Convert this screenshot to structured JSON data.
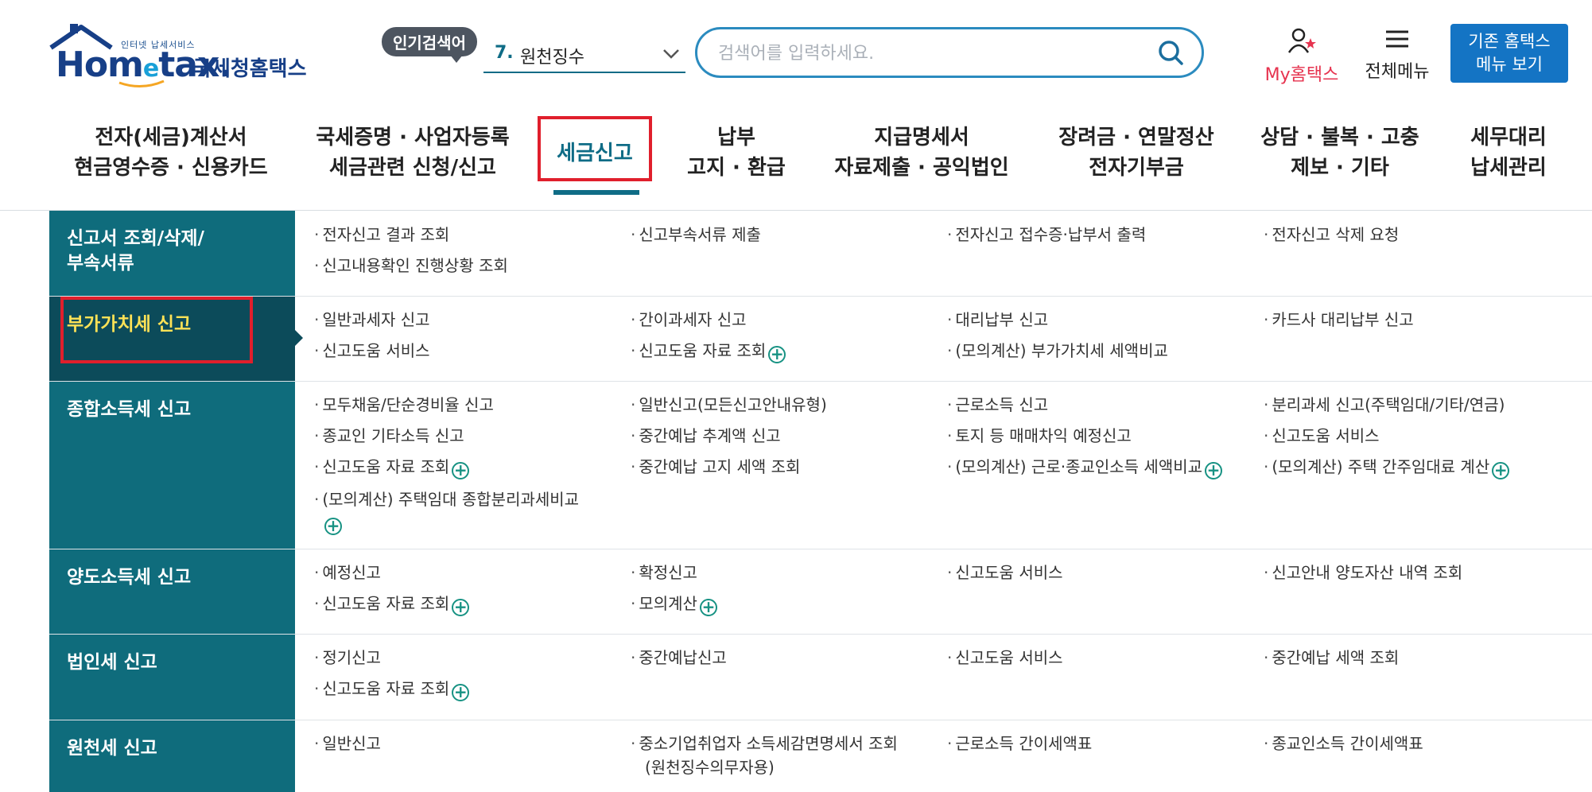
{
  "header": {
    "logo_small": "인터넷 납세서비스",
    "logo_word_a": "Hom",
    "logo_word_e": "e",
    "logo_word_b": "tax.",
    "logo_kr": "국세청홈택스",
    "popular_badge": "인기검색어",
    "popular_num": "7.",
    "popular_text": "원천징수",
    "search_placeholder": "검색어를 입력하세요.",
    "my_hometax": "My홈택스",
    "all_menu": "전체메뉴",
    "old_home_line1": "기존 홈택스",
    "old_home_line2": "메뉴 보기"
  },
  "gnb": [
    {
      "l1": "전자(세금)계산서",
      "l2": "현금영수증 · 신용카드"
    },
    {
      "l1": "국세증명 · 사업자등록",
      "l2": "세금관련 신청/신고"
    },
    {
      "l1": "세금신고",
      "l2": ""
    },
    {
      "l1": "납부",
      "l2": "고지 · 환급"
    },
    {
      "l1": "지급명세서",
      "l2": "자료제출 · 공익법인"
    },
    {
      "l1": "장려금 · 연말정산",
      "l2": "전자기부금"
    },
    {
      "l1": "상담 · 불복 · 고충",
      "l2": "제보 · 기타"
    },
    {
      "l1": "세무대리",
      "l2": "납세관리"
    }
  ],
  "rows": [
    {
      "cat": "신고서 조회/삭제/\n부속서류",
      "links": [
        "전자신고 결과 조회",
        "신고부속서류 제출",
        "전자신고 접수증·납부서 출력",
        "전자신고 삭제 요청",
        "신고내용확인 진행상황 조회"
      ]
    },
    {
      "cat": "부가가치세 신고",
      "links": [
        "일반과세자 신고",
        "간이과세자 신고",
        "대리납부 신고",
        "카드사 대리납부 신고",
        "신고도움 서비스",
        "신고도움 자료 조회",
        "(모의계산) 부가가치세 세액비교"
      ]
    },
    {
      "cat": "종합소득세 신고",
      "links": [
        "모두채움/단순경비율 신고",
        "일반신고(모든신고안내유형)",
        "근로소득 신고",
        "분리과세 신고(주택임대/기타/연금)",
        "종교인 기타소득 신고",
        "중간예납 추계액 신고",
        "토지 등 매매차익 예정신고",
        "신고도움 서비스",
        "신고도움 자료 조회",
        "중간예납 고지 세액 조회",
        "(모의계산) 근로·종교인소득 세액비교",
        "(모의계산) 주택 간주임대료 계산",
        "(모의계산) 주택임대 종합분리과세비교"
      ]
    },
    {
      "cat": "양도소득세 신고",
      "links": [
        "예정신고",
        "확정신고",
        "신고도움 서비스",
        "신고안내 양도자산 내역 조회",
        "신고도움 자료 조회",
        "모의계산"
      ]
    },
    {
      "cat": "법인세 신고",
      "links": [
        "정기신고",
        "중간예납신고",
        "신고도움 서비스",
        "중간예납 세액 조회",
        "신고도움 자료 조회"
      ]
    },
    {
      "cat": "원천세 신고",
      "links": [
        "일반신고",
        "중소기업취업자 소득세감면명세서 조회",
        "근로소득 간이세액표",
        "종교인소득 간이세액표"
      ],
      "extra": "(원천징수의무자용)"
    }
  ],
  "colors": {
    "teal": "#0f6c7c",
    "teal_dark": "#0c4b5a",
    "active_cat_text": "#ffe256",
    "highlight_red": "#e01f2c",
    "my_red": "#e6334f",
    "blue_button": "#1474c4"
  },
  "icons": [
    "house-logo-icon",
    "chevron-down-icon",
    "search-icon",
    "user-icon",
    "hamburger-icon",
    "plus-circle-icon"
  ]
}
